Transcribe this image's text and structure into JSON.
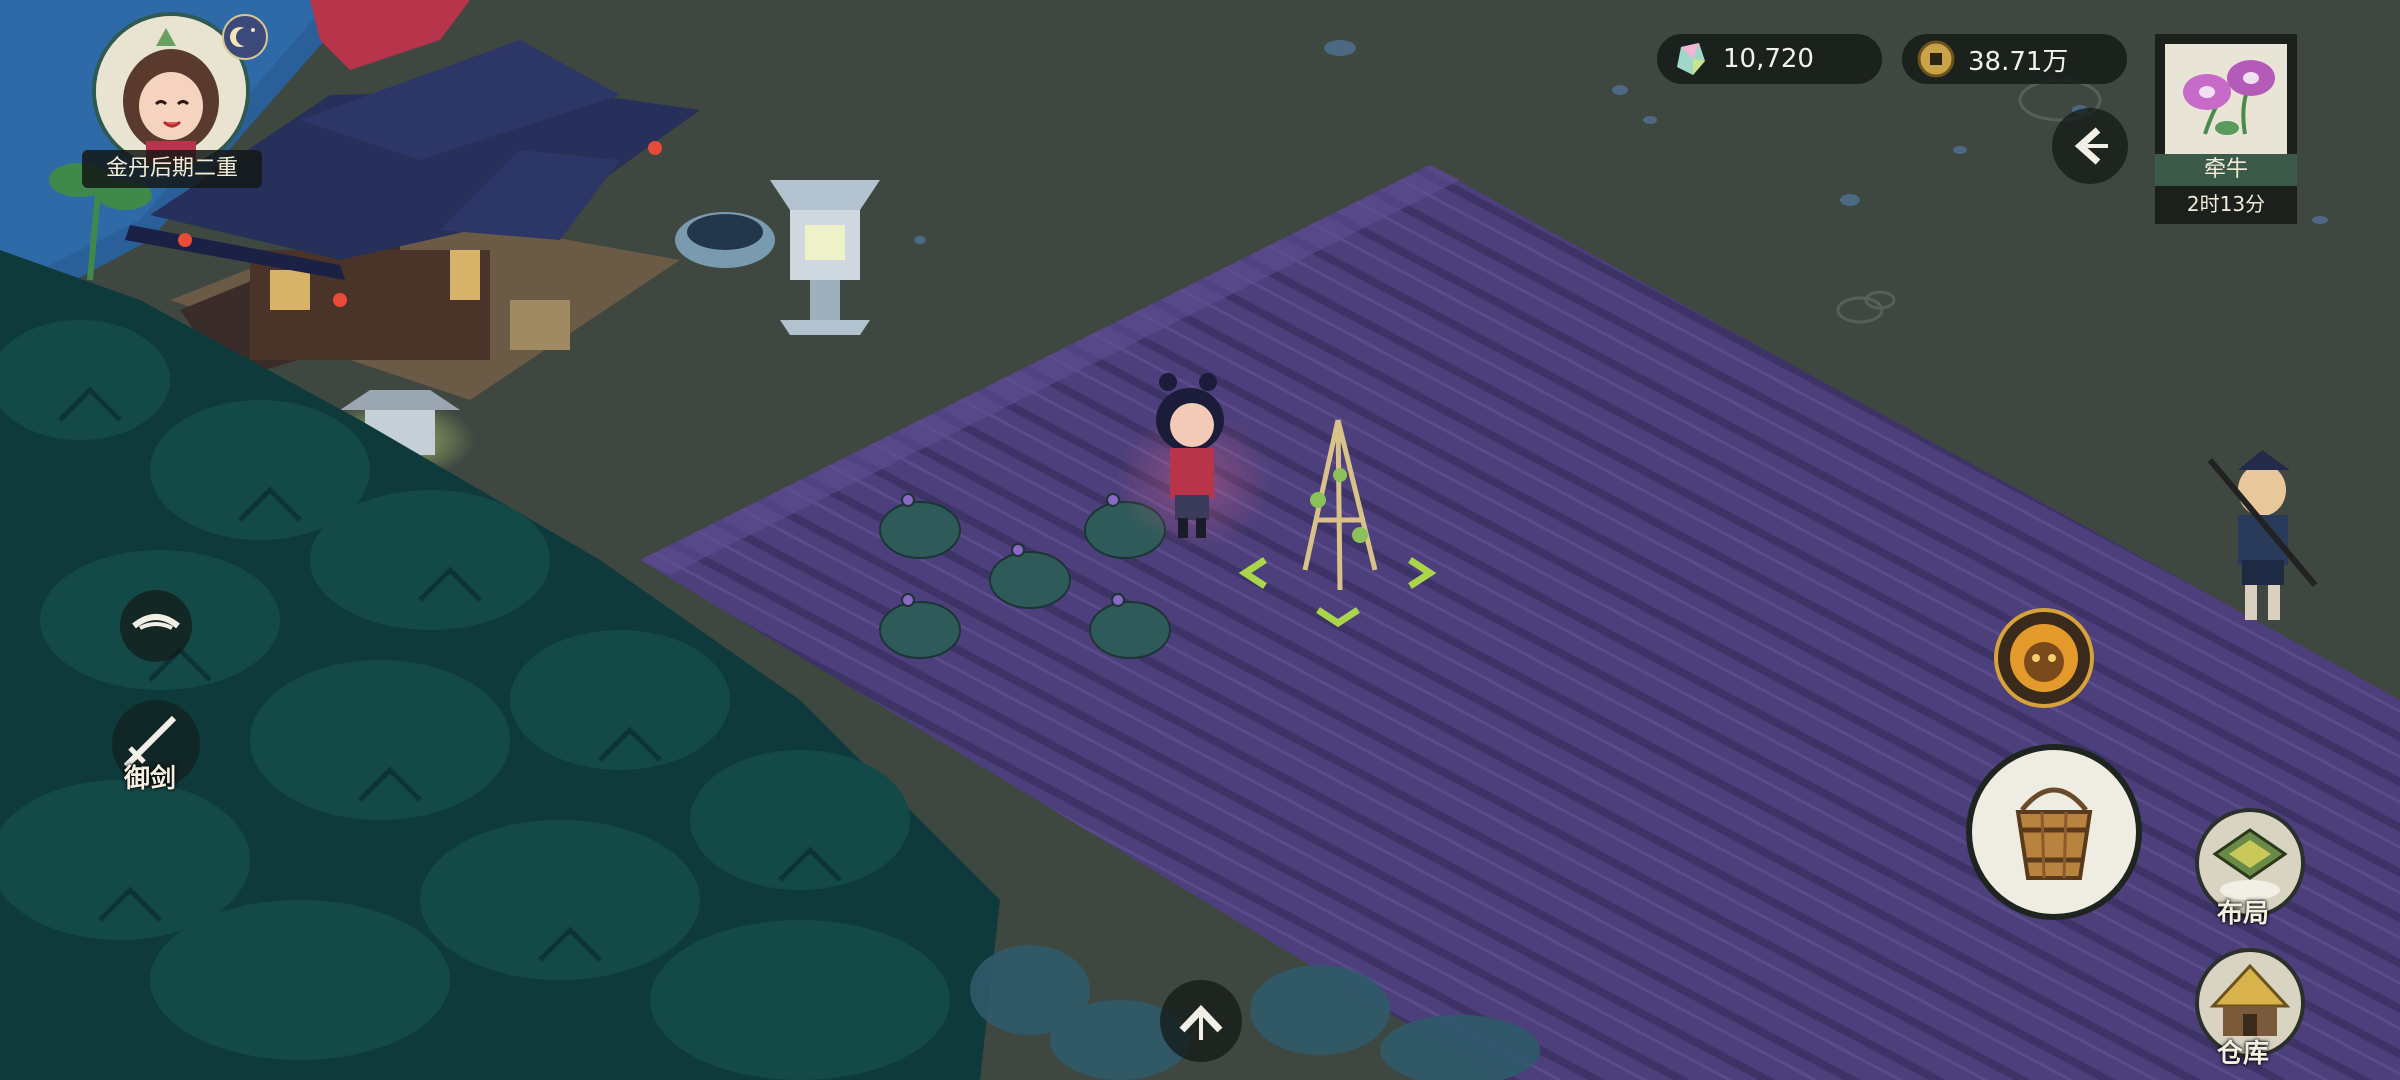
{
  "player": {
    "realm": "金丹后期二重"
  },
  "currency": {
    "crystals": "10,720",
    "coins": "38.71万"
  },
  "crop_panel": {
    "crop_name": "牵牛",
    "timer": "2时13分"
  },
  "side_menu": {
    "fly_sword_label": "御剑"
  },
  "right_menu": {
    "layout_label": "布局",
    "warehouse_label": "仓库"
  },
  "icons": {
    "crystal": "crystal-icon",
    "coin": "coin-icon",
    "back": "chevron-left-icon",
    "eye": "eye-icon",
    "sword": "sword-icon",
    "skill": "fire-face-icon",
    "bucket": "water-bucket-icon",
    "layout": "layout-grid-icon",
    "warehouse": "warehouse-hut-icon",
    "expand": "chevron-up-icon"
  },
  "colors": {
    "field": "#4c3f7b",
    "ground": "#3f4741",
    "forest": "#0f3a3c",
    "water": "#2a5f9a",
    "selection": "#a9d64a"
  }
}
